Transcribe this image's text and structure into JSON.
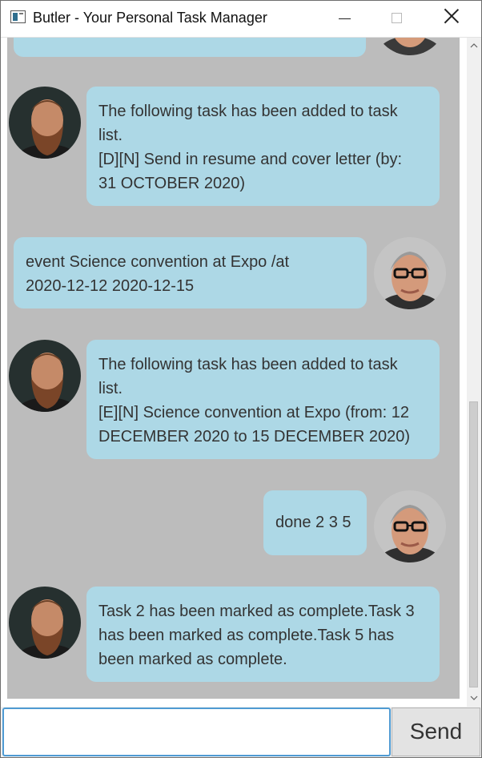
{
  "window": {
    "title": "Butler - Your Personal Task Manager"
  },
  "messages": [
    {
      "sender": "butler",
      "lines": [
        "The following task has been added to task",
        "list.",
        "[D][N] Send in resume and cover letter (by:",
        "31 OCTOBER 2020)"
      ]
    },
    {
      "sender": "user",
      "lines": [
        "event Science convention at Expo /at",
        "2020-12-12 2020-12-15"
      ]
    },
    {
      "sender": "butler",
      "lines": [
        "The following task has been added to task",
        "list.",
        "[E][N] Science convention at Expo (from: 12",
        "DECEMBER 2020 to 15 DECEMBER 2020)"
      ]
    },
    {
      "sender": "user",
      "lines": [
        "done 2 3 5"
      ]
    },
    {
      "sender": "butler",
      "lines": [
        "Task 2 has been marked as complete.Task 3",
        "has been marked as complete.Task 5 has",
        "been marked as complete."
      ]
    }
  ],
  "input": {
    "value": "",
    "placeholder": ""
  },
  "send_button": {
    "label": "Send"
  },
  "colors": {
    "bubble": "#add8e6",
    "chat_background": "#bcbcbc",
    "input_focus": "#4f9bd3"
  }
}
